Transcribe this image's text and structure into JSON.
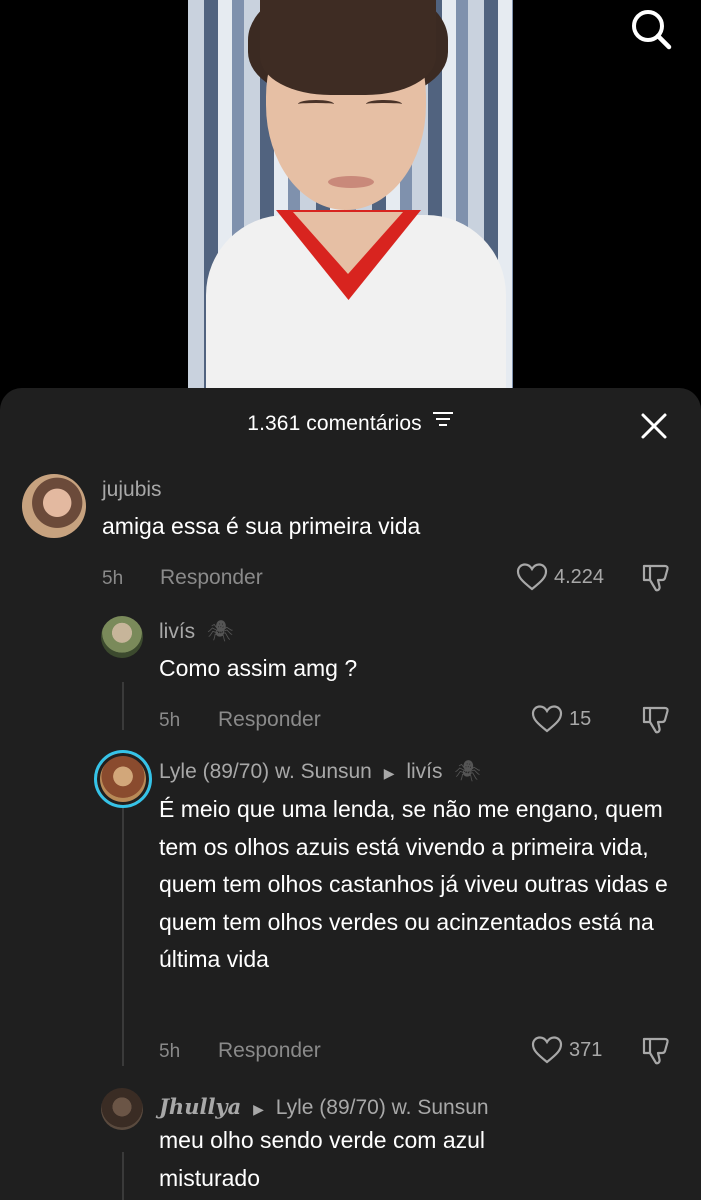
{
  "search": {
    "icon": "search-icon"
  },
  "comments_panel": {
    "count_label": "1.361 comentários",
    "filter_icon": "filter-icon",
    "close_icon": "close-icon"
  },
  "comments": [
    {
      "username": "jujubis",
      "text": "amiga essa é sua primeira vida",
      "time": "5h",
      "reply_label": "Responder",
      "likes": "4.224"
    },
    {
      "username": "livís",
      "username_emoji": "🕷",
      "text": "Como assim amg ?",
      "time": "5h",
      "reply_label": "Responder",
      "likes": "15"
    },
    {
      "username": "Lyle (89/70) w. Sunsun",
      "reply_to": "livís",
      "reply_to_emoji": "🕷",
      "text": "É meio que uma lenda, se não me engano, quem tem os olhos azuis está vivendo a primeira vida, quem tem olhos castanhos já viveu outras vidas e quem tem olhos verdes ou acinzentados está na última vida",
      "time": "5h",
      "reply_label": "Responder",
      "likes": "371"
    },
    {
      "username": "Jhullya",
      "reply_to": "Lyle (89/70) w. Sunsun",
      "text": "meu olho sendo verde com azul misturado"
    }
  ],
  "colors": {
    "sheet_bg": "#1f1f1f",
    "muted_text": "#a8a8a8",
    "story_ring": "#35c3e8"
  }
}
